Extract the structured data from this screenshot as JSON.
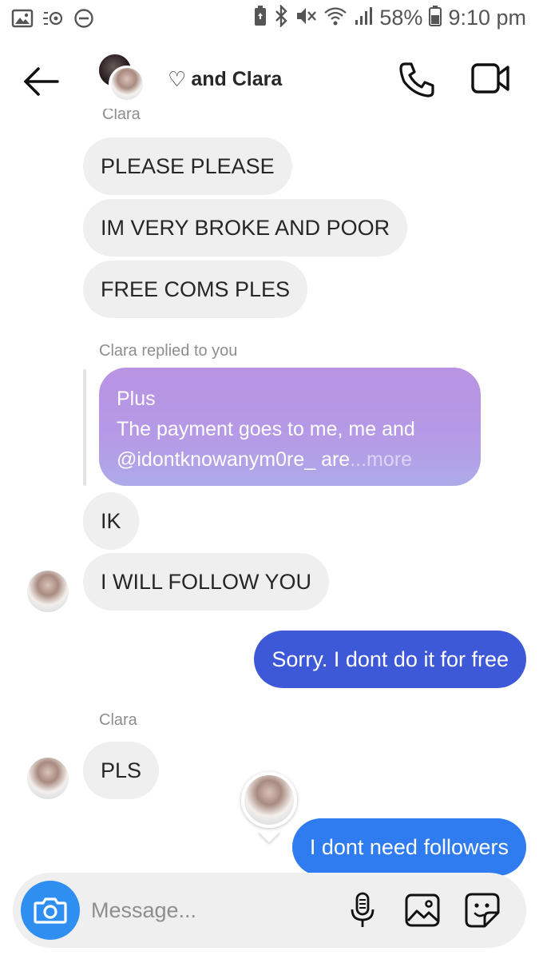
{
  "status_bar": {
    "battery": "58%",
    "time": "9:10 pm"
  },
  "header": {
    "heart": "♡",
    "title": "and Clara"
  },
  "messages": {
    "sender_cut": "Clara",
    "m1": "PLEASE PLEASE",
    "m2": "IM VERY BROKE AND POOR",
    "m3": "FREE COMS PLES",
    "reply_label": "Clara replied to you",
    "reply_line1": "Plus",
    "reply_line2": "The payment goes to me, me and",
    "reply_line3_main": "@idontknowanym0re_ are",
    "reply_more": "...more",
    "m4": "IK",
    "m5": "I WILL  FOLLOW YOU",
    "out1": "Sorry. I dont do it for free",
    "sender2": "Clara",
    "m6": "PLS",
    "out2": "I dont need followers"
  },
  "composer": {
    "placeholder": "Message..."
  },
  "colors": {
    "outgoing": "#3e59d8",
    "outgoing_latest": "#2f7bf0",
    "incoming": "#efefef",
    "reply_bubble": "#b893e3",
    "camera_button": "#2f8ff0"
  },
  "icons": [
    "gallery-icon",
    "eye-comfort-icon",
    "dnd-icon",
    "bluetooth-icon",
    "mute-icon",
    "wifi-icon",
    "signal-icon",
    "battery-icon",
    "back-arrow-icon",
    "phone-icon",
    "video-icon",
    "camera-icon",
    "microphone-icon",
    "image-icon",
    "sticker-icon"
  ]
}
